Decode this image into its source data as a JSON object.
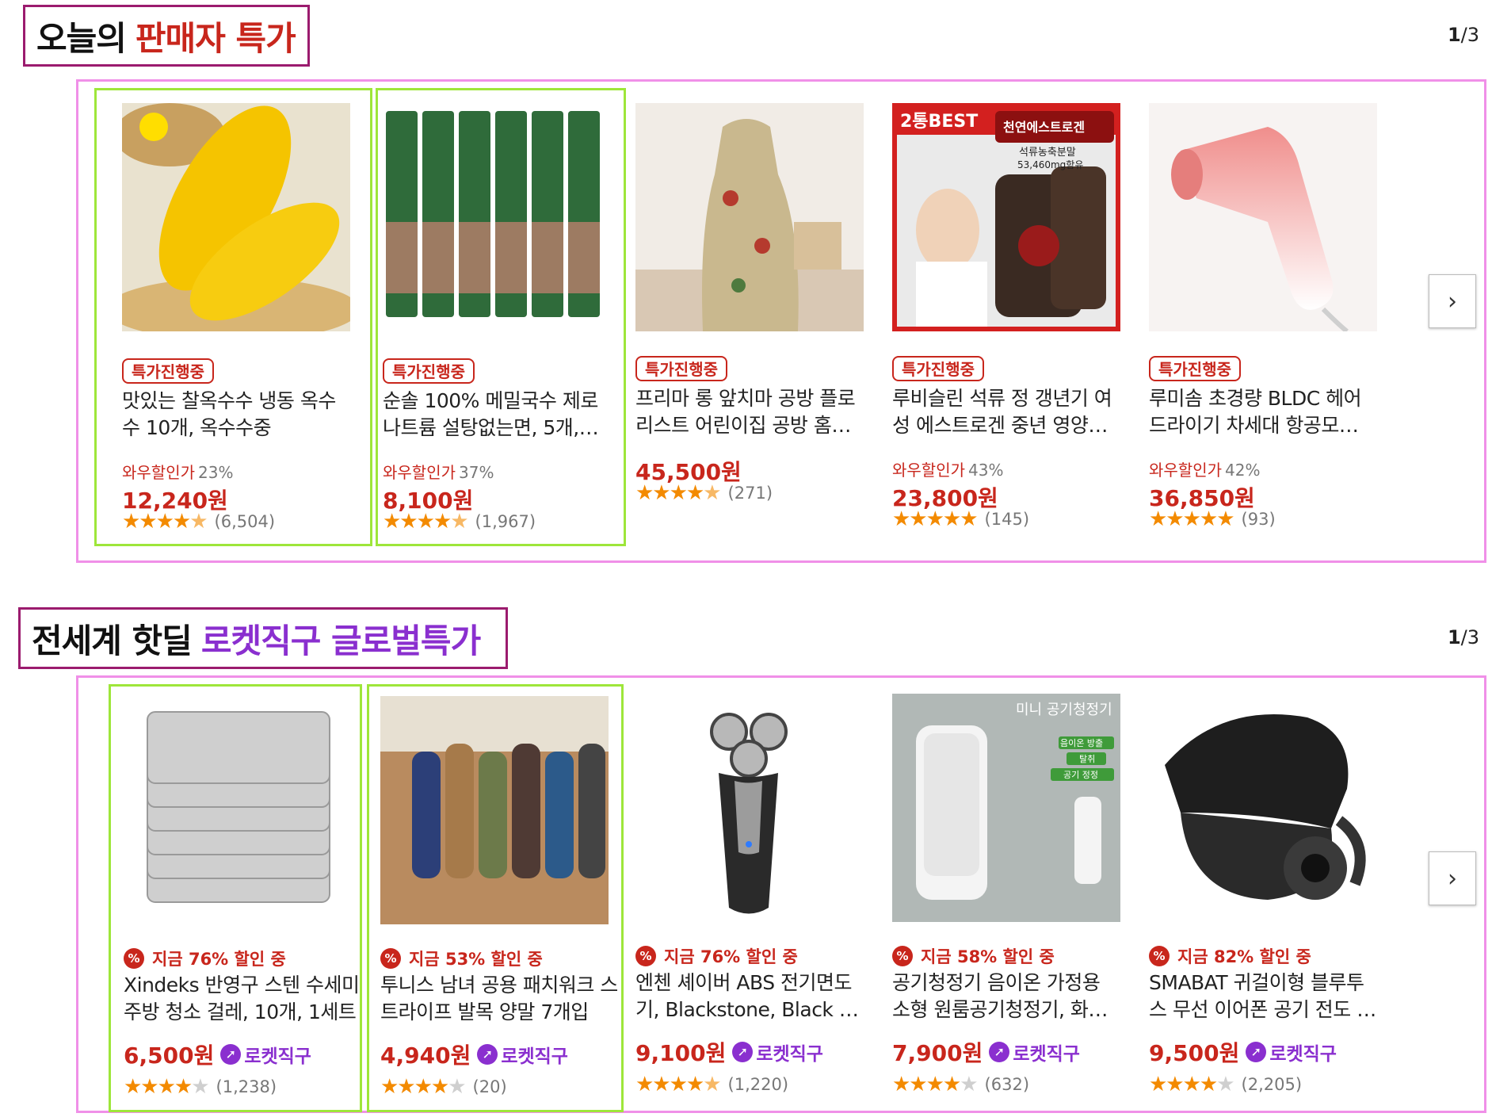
{
  "sections": [
    {
      "heading_plain": "오늘의",
      "heading_accent": "판매자 특가",
      "accent_color": "#c8261c",
      "pager_current": "1",
      "pager_total": "/3",
      "products": [
        {
          "badge": "특가진행중",
          "title": "맛있는 찰옥수수 냉동 옥수수 10개, 옥수수중",
          "discount_label": "와우할인가",
          "discount_rate": "23%",
          "price": "12,240원",
          "stars": 4.5,
          "review_count": "(6,504)",
          "image_icon": "corn-image"
        },
        {
          "badge": "특가진행중",
          "title": "순솔 100% 메밀국수 제로 나트륨 설탕없는면, 5개,…",
          "discount_label": "와우할인가",
          "discount_rate": "37%",
          "price": "8,100원",
          "stars": 4.5,
          "review_count": "(1,967)",
          "image_icon": "buckwheat-noodle-image"
        },
        {
          "badge": "특가진행중",
          "title": "프리마 롱 앞치마 공방 플로리스트 어린이집 공방 홈…",
          "discount_label": "",
          "discount_rate": "",
          "price": "45,500원",
          "stars": 4.5,
          "review_count": "(271)",
          "image_icon": "apron-image"
        },
        {
          "badge": "특가진행중",
          "title": "루비슬린 석류 정 갱년기 여성 에스트로겐 중년 영양…",
          "discount_label": "와우할인가",
          "discount_rate": "43%",
          "price": "23,800원",
          "stars": 5,
          "review_count": "(145)",
          "image_icon": "supplement-image",
          "image_text": {
            "tag": "2통BEST",
            "top": "천연에스트로겐",
            "sub": "석류농축분말",
            "sub2": "53,460mg함유"
          }
        },
        {
          "badge": "특가진행중",
          "title": "루미솜 초경량 BLDC 헤어 드라이기 차세대 항공모…",
          "discount_label": "와우할인가",
          "discount_rate": "42%",
          "price": "36,850원",
          "stars": 5,
          "review_count": "(93)",
          "image_icon": "hair-dryer-image"
        }
      ]
    },
    {
      "heading_plain": "전세계 핫딜",
      "heading_accent": "로켓직구 글로벌특가",
      "accent_color": "#8a2fcf",
      "pager_current": "1",
      "pager_total": "/3",
      "products": [
        {
          "deal": "지금 76% 할인 중",
          "title": "Xindeks 반영구 스텐 수세미 주방 청소 걸레, 10개, 1세트",
          "price": "6,500원",
          "rocket": "로켓직구",
          "stars": 4,
          "review_count": "(1,238)",
          "image_icon": "scrubber-cloth-image"
        },
        {
          "deal": "지금 53% 할인 중",
          "title": "투니스 남녀 공용 패치워크 스트라이프 발목 양말 7개입",
          "price": "4,940원",
          "rocket": "로켓직구",
          "stars": 4,
          "review_count": "(20)",
          "image_icon": "socks-image"
        },
        {
          "deal": "지금 76% 할인 중",
          "title": "엔첸 셰이버 ABS 전기면도기, Blackstone, Black + Silver",
          "price": "9,100원",
          "rocket": "로켓직구",
          "stars": 4.5,
          "review_count": "(1,220)",
          "image_icon": "shaver-image"
        },
        {
          "deal": "지금 58% 할인 중",
          "title": "공기청정기 음이온 가정용 소형 원룸공기청정기, 화이트",
          "price": "7,900원",
          "rocket": "로켓직구",
          "stars": 4,
          "review_count": "(632)",
          "image_icon": "air-purifier-image",
          "image_text": {
            "top": "미니 공기청정기",
            "t1": "음이온 방출",
            "t2": "탈취",
            "t3": "공기 정정"
          }
        },
        {
          "deal": "지금 82% 할인 중",
          "title": "SMABAT 귀걸이형 블루투스 무선 이어폰 공기 전도 블루투스…",
          "price": "9,500원",
          "rocket": "로켓직구",
          "stars": 4,
          "review_count": "(2,205)",
          "image_icon": "earbuds-image"
        }
      ]
    }
  ],
  "icons": {
    "next": "chevron-right-icon",
    "deal": "percent-icon",
    "rocket": "rocket-icon",
    "star": "star-icon"
  }
}
